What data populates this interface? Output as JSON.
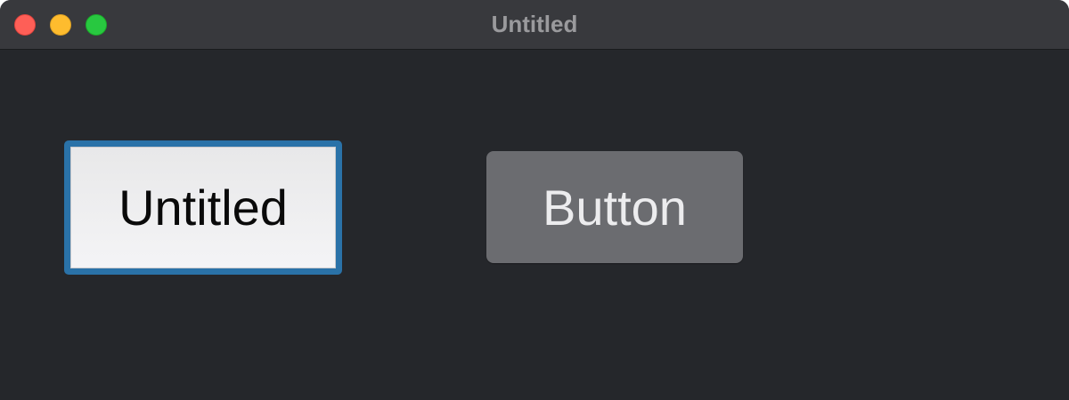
{
  "window": {
    "title": "Untitled"
  },
  "text_field": {
    "value": "Untitled"
  },
  "button": {
    "label": "Button"
  }
}
